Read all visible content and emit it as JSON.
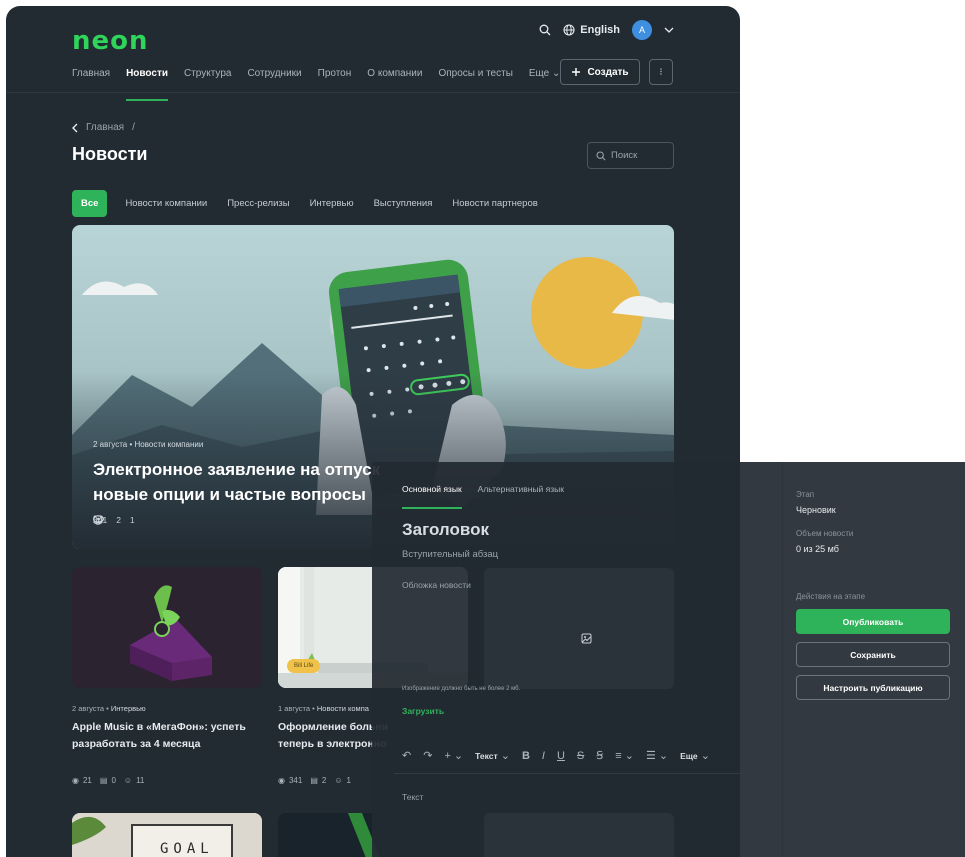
{
  "header": {
    "logo": "neon",
    "language": "English",
    "avatar_initial": "A",
    "create_label": "Создать"
  },
  "nav": {
    "items": [
      {
        "label": "Главная"
      },
      {
        "label": "Новости"
      },
      {
        "label": "Структура"
      },
      {
        "label": "Сотрудники"
      },
      {
        "label": "Протон"
      },
      {
        "label": "О компании"
      },
      {
        "label": "Опросы и тесты"
      },
      {
        "label": "Еще"
      }
    ],
    "active_index": 1
  },
  "breadcrumb": {
    "home": "Главная",
    "sep": "/"
  },
  "page": {
    "title": "Новости",
    "search_placeholder": "Поиск"
  },
  "filters": [
    "Все",
    "Новости компании",
    "Пресс-релизы",
    "Интервью",
    "Выступления",
    "Новости партнеров"
  ],
  "hero": {
    "date": "2 августа",
    "category": "Новости компании",
    "title_line1": "Электронное заявление на отпуск",
    "title_line2": "новые опции и частые вопросы",
    "views": "341",
    "comments": "2",
    "reactions": "1"
  },
  "cards": [
    {
      "date": "2 августа",
      "category": "Интервью",
      "title_line1": "Apple Music в «МегаФон»: успеть",
      "title_line2": "разработать за 4 месяца",
      "views": "21",
      "comments": "0",
      "reactions": "11"
    },
    {
      "date": "1 августа",
      "category": "Новости компа",
      "badge": "Bill Life",
      "title_line1": "Оформление больни",
      "title_line2": "теперь в электронно",
      "views": "341",
      "comments": "2",
      "reactions": "1"
    }
  ],
  "bottom_card": {
    "text": "GOAL"
  },
  "editor": {
    "tabs": [
      "Основной язык",
      "Альтернативный язык"
    ],
    "title_placeholder": "Заголовок",
    "lead_placeholder": "Вступительный абзац",
    "cover_label": "Обложка новости",
    "image_hint": "Изображение должно быть не более 2 мб.",
    "upload_label": "Загрузить",
    "toolbar": {
      "text_style": "Текст",
      "more": "Еще"
    },
    "body_placeholder": "Текст",
    "sidebar": {
      "stage_label": "Этап",
      "stage_value": "Черновик",
      "size_label": "Объем новости",
      "size_value": "0 из 25 мб",
      "actions_label": "Действия на этапе",
      "publish": "Опубликовать",
      "save": "Сохранить",
      "configure": "Настроить публикацию"
    }
  },
  "colors": {
    "accent": "#2fb35a",
    "logo": "#2fd45a",
    "background": "#222a32",
    "avatar": "#3f8fe0"
  }
}
